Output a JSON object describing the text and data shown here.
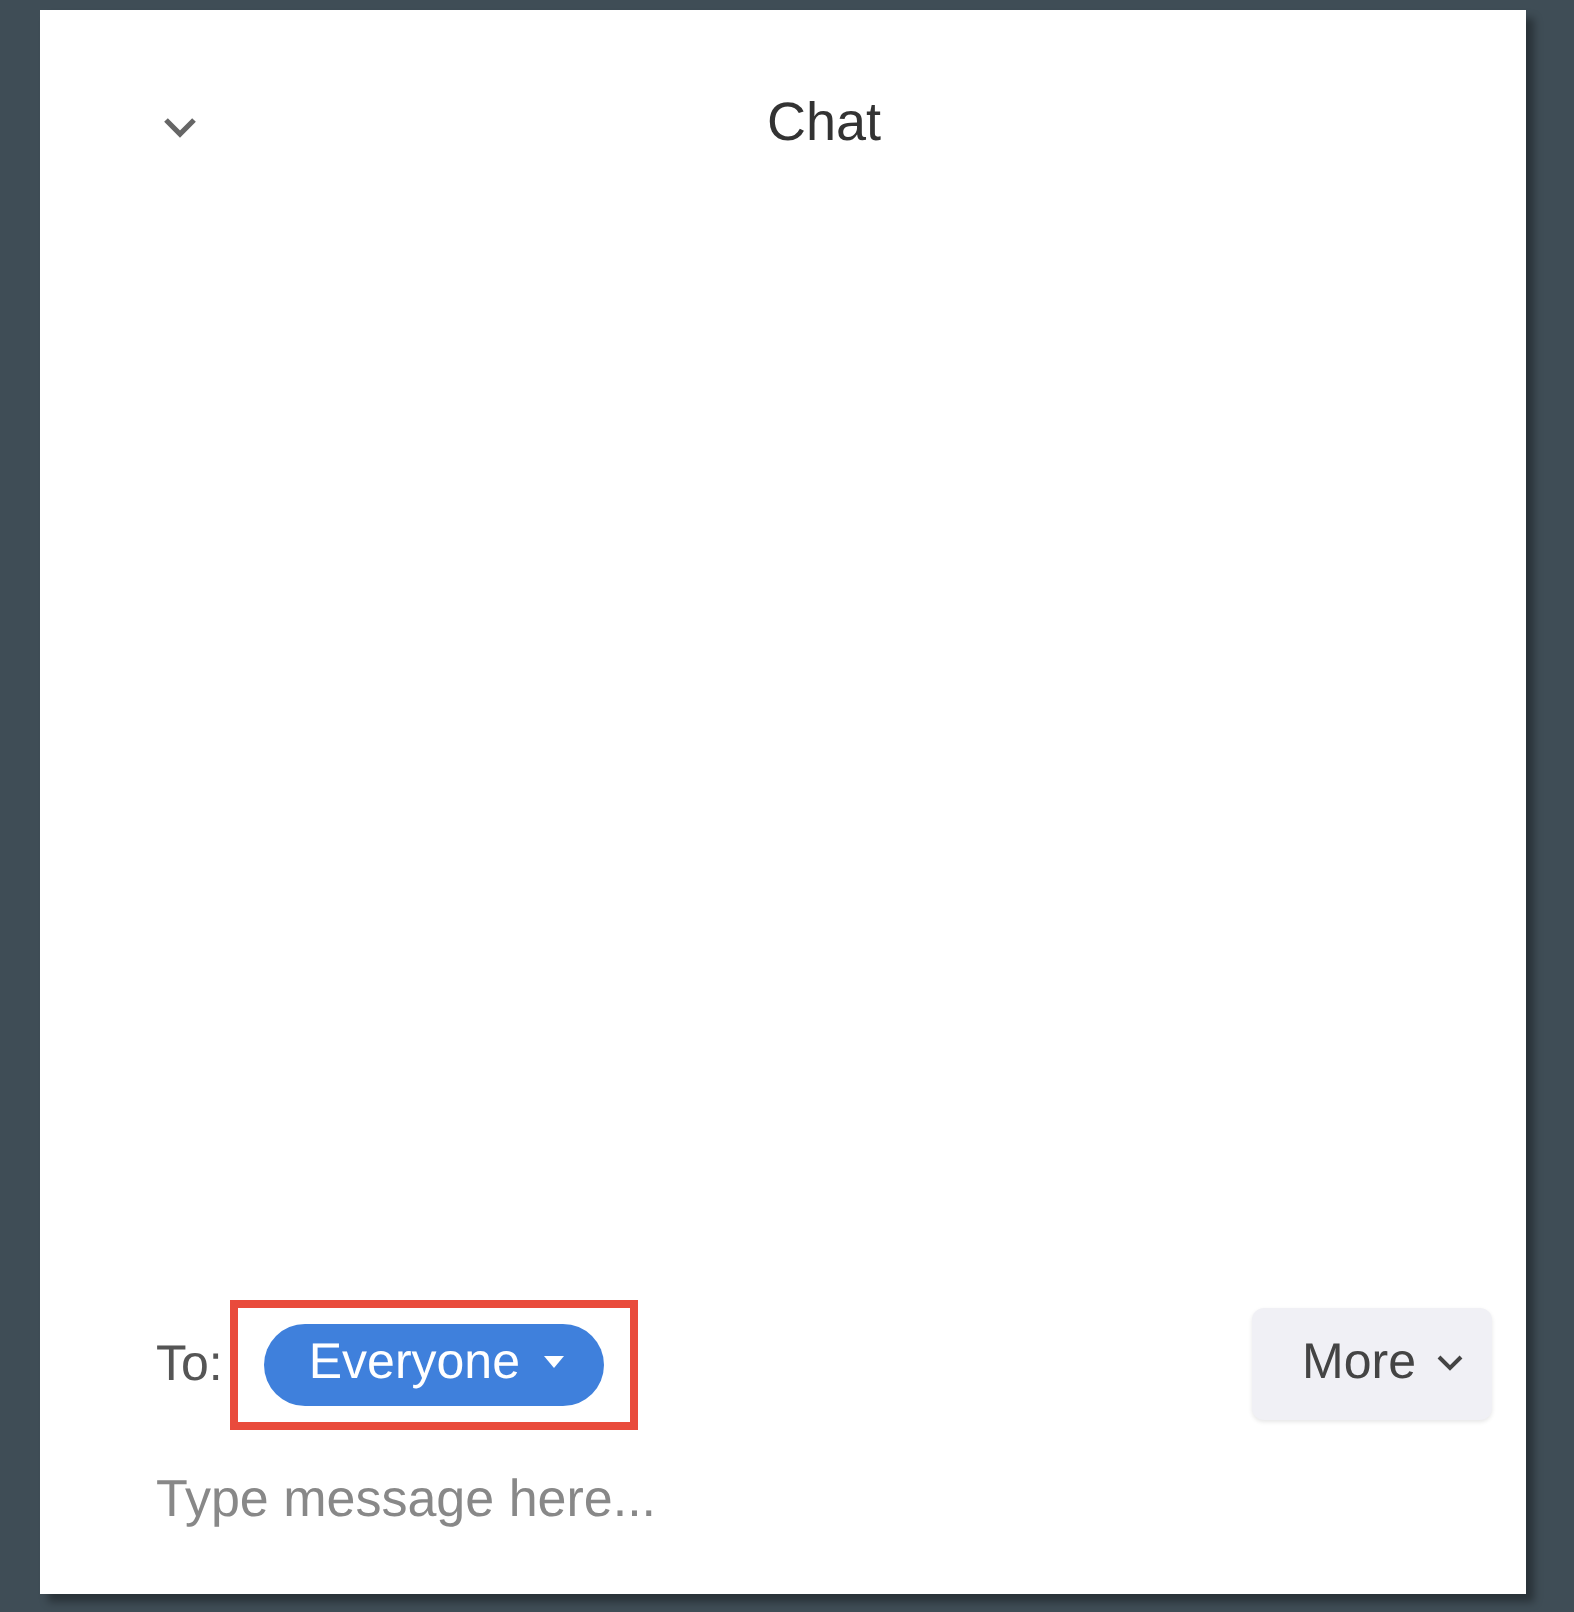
{
  "header": {
    "title": "Chat"
  },
  "recipient": {
    "label": "To:",
    "value": "Everyone",
    "highlighted": true
  },
  "more_button": {
    "label": "More"
  },
  "message": {
    "placeholder": "Type message here..."
  }
}
